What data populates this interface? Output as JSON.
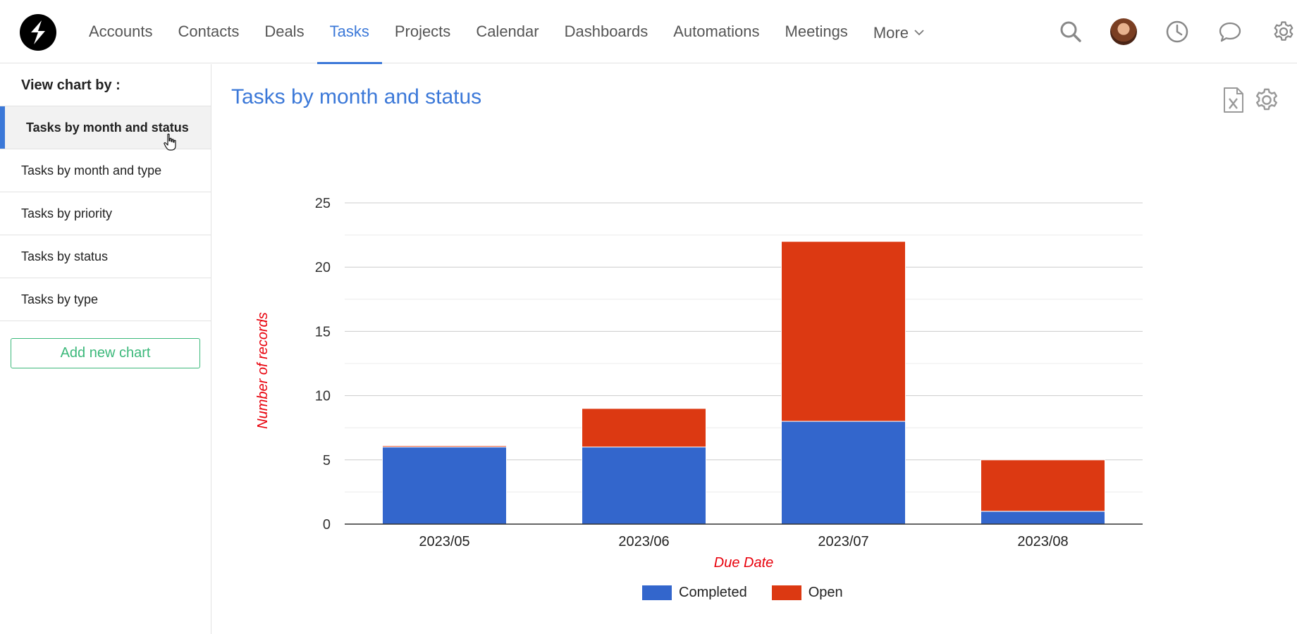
{
  "nav": {
    "items": [
      {
        "label": "Accounts",
        "active": false
      },
      {
        "label": "Contacts",
        "active": false
      },
      {
        "label": "Deals",
        "active": false
      },
      {
        "label": "Tasks",
        "active": true
      },
      {
        "label": "Projects",
        "active": false
      },
      {
        "label": "Calendar",
        "active": false
      },
      {
        "label": "Dashboards",
        "active": false
      },
      {
        "label": "Automations",
        "active": false
      },
      {
        "label": "Meetings",
        "active": false
      }
    ],
    "more_label": "More",
    "tools": [
      "search-icon",
      "avatar",
      "clock-icon",
      "chat-icon",
      "gear-icon"
    ]
  },
  "sidebar": {
    "title": "View chart by :",
    "items": [
      {
        "label": "Tasks by month and status",
        "active": true
      },
      {
        "label": "Tasks by month and type",
        "active": false
      },
      {
        "label": "Tasks by priority",
        "active": false
      },
      {
        "label": "Tasks by status",
        "active": false
      },
      {
        "label": "Tasks by type",
        "active": false
      }
    ],
    "add_button": "Add new chart"
  },
  "main": {
    "title": "Tasks by month and status",
    "tools": [
      "excel-export-icon",
      "gear-icon"
    ]
  },
  "colors": {
    "accent": "#3b78d8",
    "completed": "#3366cc",
    "open": "#dc3912",
    "axis_label": "#e8000b",
    "add_button": "#3bb87a"
  },
  "chart_data": {
    "type": "bar",
    "stacked": true,
    "categories": [
      "2023/05",
      "2023/06",
      "2023/07",
      "2023/08"
    ],
    "series": [
      {
        "name": "Completed",
        "values": [
          6,
          6,
          8,
          1
        ]
      },
      {
        "name": "Open",
        "values": [
          0.1,
          3,
          14,
          4
        ]
      }
    ],
    "xlabel": "Due Date",
    "ylabel": "Number of records",
    "ylim": [
      0,
      25
    ],
    "yticks": [
      0,
      5,
      10,
      15,
      20,
      25
    ],
    "grid": true,
    "legend": "bottom"
  }
}
